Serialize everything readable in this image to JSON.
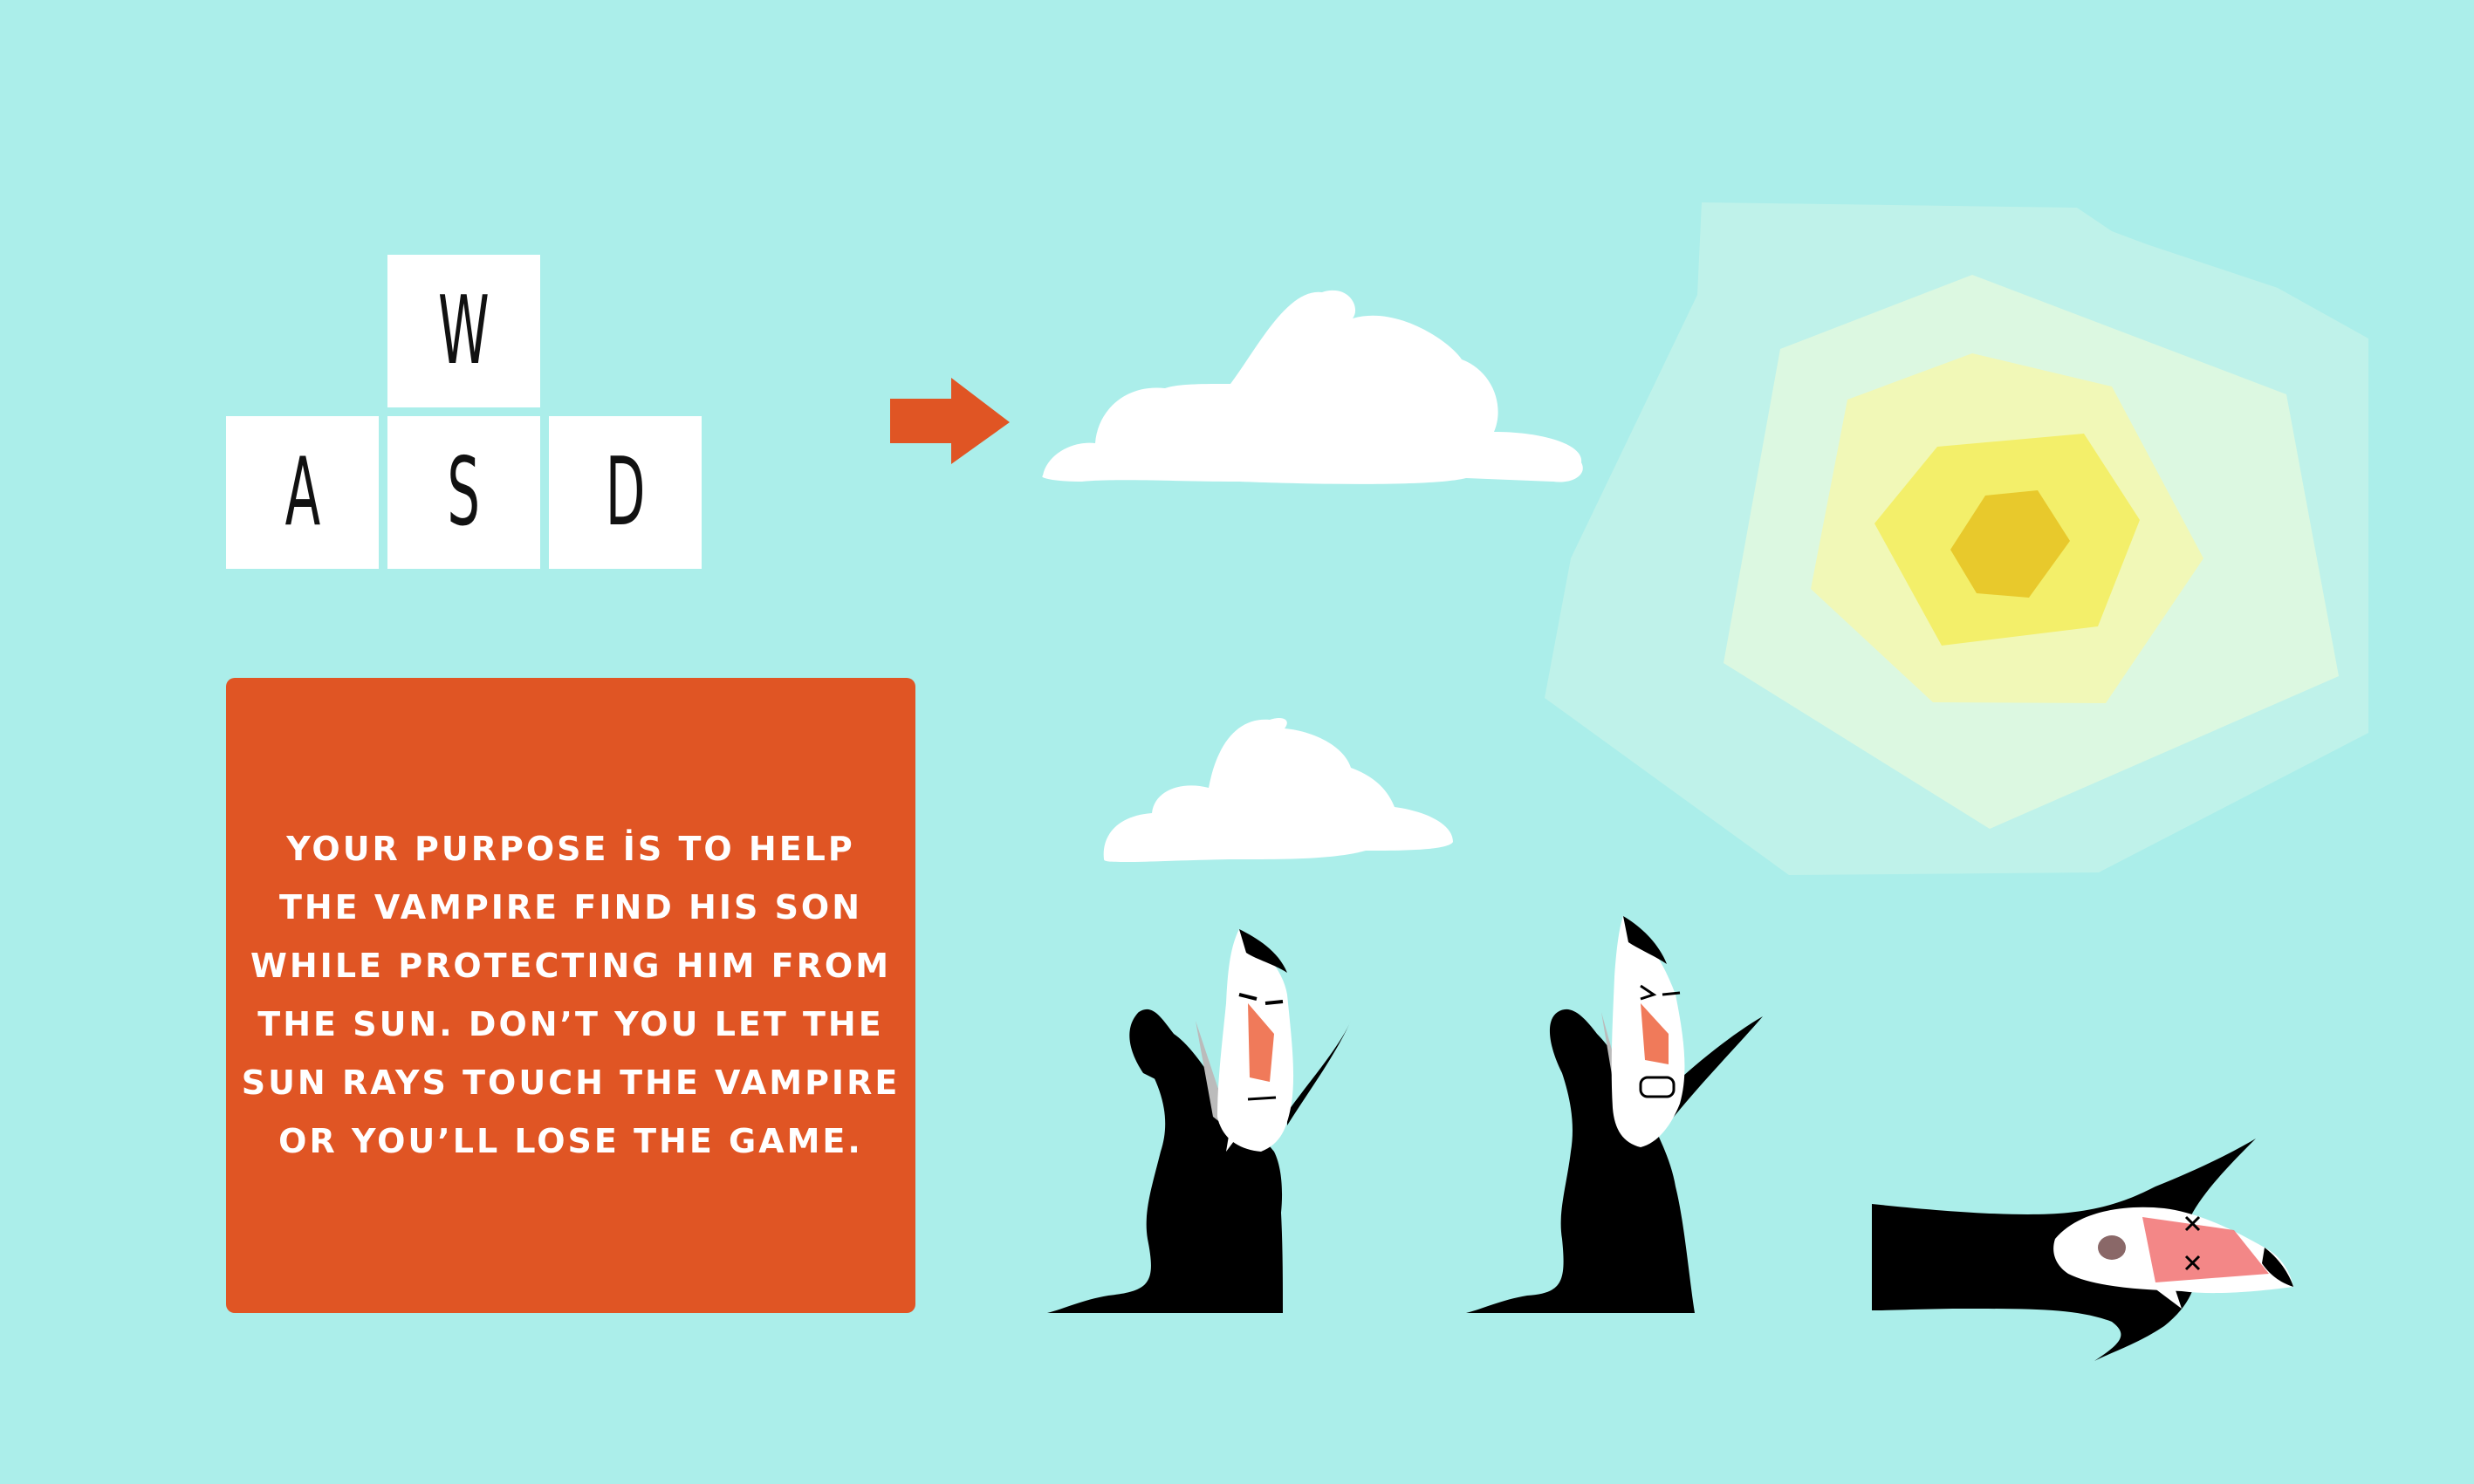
{
  "controls": {
    "keys": {
      "up": "W",
      "left": "A",
      "down": "S",
      "right": "D"
    }
  },
  "instructions": {
    "lines": [
      "YOUR PURPOSE İS TO HELP",
      "THE VAMPIRE FIND HIS SON",
      "WHILE PROTECTING HIM FROM",
      "THE SUN. DON’T YOU LET THE",
      "SUN RAYS TOUCH THE VAMPIRE",
      "OR YOU’LL LOSE THE GAME."
    ]
  },
  "colors": {
    "background": "#abeeea",
    "panel": "#e05524",
    "arrow": "#e05524",
    "sun_core": "#e8c92c",
    "sun_inner": "#f3ef6a",
    "sun_mid": "#f1f8b7",
    "sun_outer": "#dcf8e1",
    "sun_halo": "#bff2ea",
    "cloud": "#ffffff",
    "cape": "#000000",
    "face": "#ffffff",
    "nose": "#f07a5a"
  },
  "icons": {
    "arrow": "right-arrow-icon",
    "sun": "sun-icon",
    "cloud": "cloud-icon",
    "vampire_idle": "vampire-idle-icon",
    "vampire_hurt": "vampire-hurt-icon",
    "vampire_dead": "vampire-dead-icon"
  }
}
